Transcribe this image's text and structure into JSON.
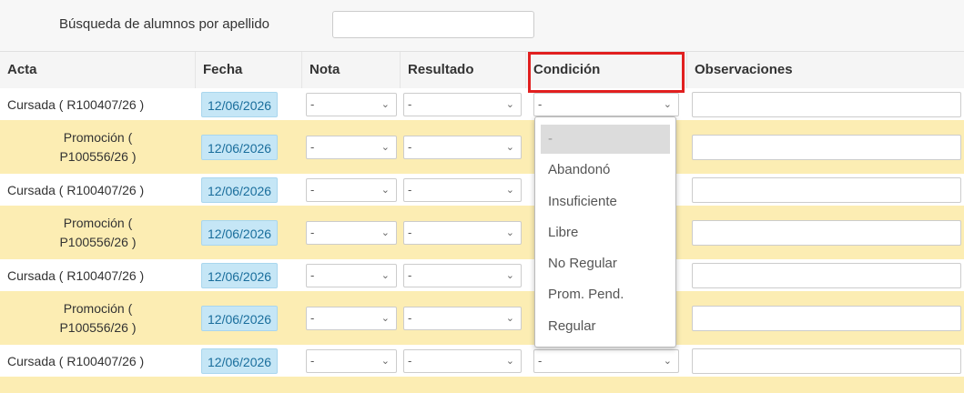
{
  "search": {
    "label": "Búsqueda de alumnos por apellido",
    "value": ""
  },
  "table": {
    "headers": {
      "acta": "Acta",
      "fecha": "Fecha",
      "nota": "Nota",
      "resultado": "Resultado",
      "condicion": "Condición",
      "observaciones": "Observaciones"
    },
    "rows": [
      {
        "acta": "Cursada ( R100407/26 )",
        "acta_l1": "",
        "acta_l2": "",
        "fecha": "12/06/2026",
        "nota": "-",
        "resultado": "-",
        "condicion": "-",
        "observaciones": ""
      },
      {
        "acta": "",
        "acta_l1": "Promoción (",
        "acta_l2": "P100556/26 )",
        "fecha": "12/06/2026",
        "nota": "-",
        "resultado": "-",
        "condicion": "",
        "observaciones": ""
      },
      {
        "acta": "Cursada ( R100407/26 )",
        "acta_l1": "",
        "acta_l2": "",
        "fecha": "12/06/2026",
        "nota": "-",
        "resultado": "-",
        "condicion": "",
        "observaciones": ""
      },
      {
        "acta": "",
        "acta_l1": "Promoción (",
        "acta_l2": "P100556/26 )",
        "fecha": "12/06/2026",
        "nota": "-",
        "resultado": "-",
        "condicion": "",
        "observaciones": ""
      },
      {
        "acta": "Cursada ( R100407/26 )",
        "acta_l1": "",
        "acta_l2": "",
        "fecha": "12/06/2026",
        "nota": "-",
        "resultado": "-",
        "condicion": "",
        "observaciones": ""
      },
      {
        "acta": "",
        "acta_l1": "Promoción (",
        "acta_l2": "P100556/26 )",
        "fecha": "12/06/2026",
        "nota": "-",
        "resultado": "-",
        "condicion": "",
        "observaciones": ""
      },
      {
        "acta": "Cursada ( R100407/26 )",
        "acta_l1": "",
        "acta_l2": "",
        "fecha": "12/06/2026",
        "nota": "-",
        "resultado": "-",
        "condicion": "-",
        "observaciones": ""
      }
    ]
  },
  "condicion_dropdown": {
    "options": [
      "-",
      "Abandonó",
      "Insuficiente",
      "Libre",
      "No Regular",
      "Prom. Pend.",
      "Regular"
    ],
    "selected": "-"
  },
  "colors": {
    "promocion_row_bg": "#fcedb3",
    "date_bg": "#c5e6f6",
    "highlight": "#e11f1f"
  },
  "icons": {
    "select_chevron": "chevron-down-icon"
  }
}
